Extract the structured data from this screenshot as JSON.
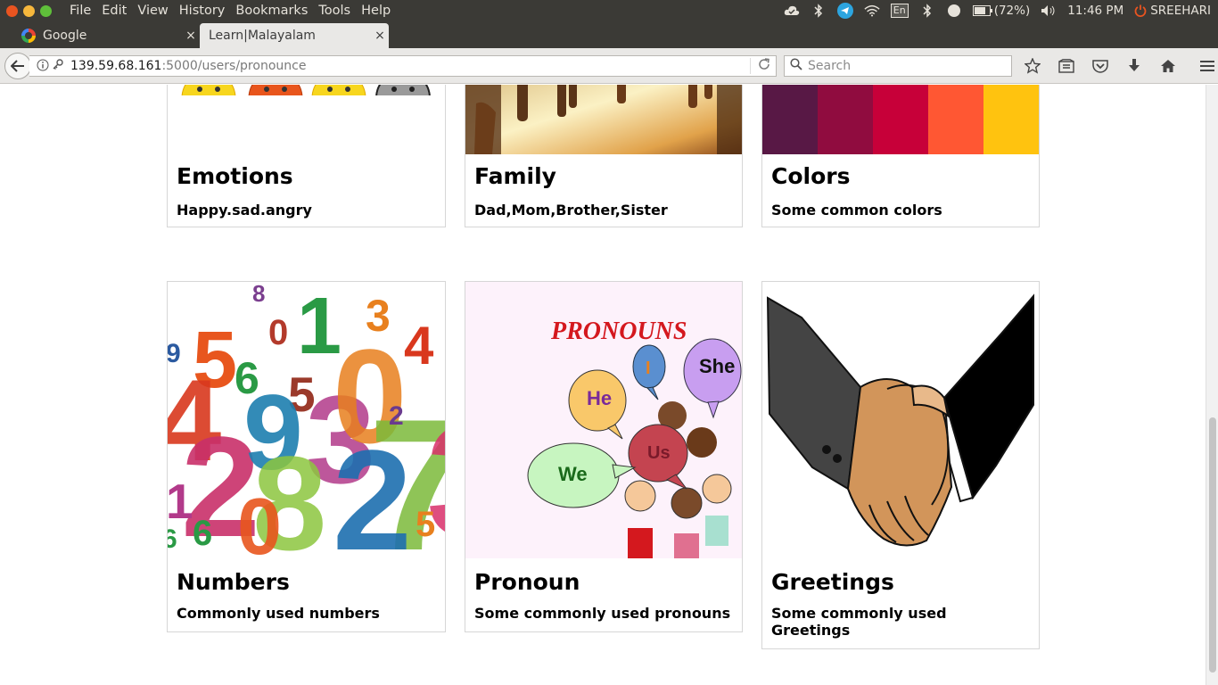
{
  "menubar": {
    "items": [
      "File",
      "Edit",
      "View",
      "History",
      "Bookmarks",
      "Tools",
      "Help"
    ],
    "battery": "(72%)",
    "keyboard": "En",
    "time": "11:46 PM",
    "user": "SREEHARI"
  },
  "tabs": [
    {
      "title": "Google",
      "close": "×"
    },
    {
      "title": "Learn|Malayalam",
      "close": "×"
    }
  ],
  "newtab": "+",
  "urlbar": {
    "host": "139.59.68.161",
    "path": ":5000/users/pronounce"
  },
  "search": {
    "placeholder": "Search"
  },
  "cards": [
    {
      "title": "Emotions",
      "desc": "Happy.sad.angry"
    },
    {
      "title": "Family",
      "desc": "Dad,Mom,Brother,Sister"
    },
    {
      "title": "Colors",
      "desc": "Some common colors"
    },
    {
      "title": "Numbers",
      "desc": "Commonly used numbers"
    },
    {
      "title": "Pronoun",
      "desc": "Some commonly used pronouns"
    },
    {
      "title": "Greetings",
      "desc": "Some commonly used Greetings"
    }
  ],
  "pronoun_image": {
    "heading": "PRONOUNS",
    "bubbles": [
      "I",
      "She",
      "He",
      "Us",
      "We"
    ]
  },
  "numbers_image": {
    "digits": [
      "8",
      "1",
      "3",
      "5",
      "0",
      "4",
      "9",
      "6",
      "5",
      "2",
      "9",
      "3",
      "0",
      "4",
      "7",
      "2",
      "8",
      "3",
      "2",
      "1",
      "6",
      "0",
      "5",
      "6"
    ]
  },
  "colors_swatches": [
    "#581845",
    "#900c3f",
    "#c70039",
    "#ff5733",
    "#ffc30f"
  ]
}
